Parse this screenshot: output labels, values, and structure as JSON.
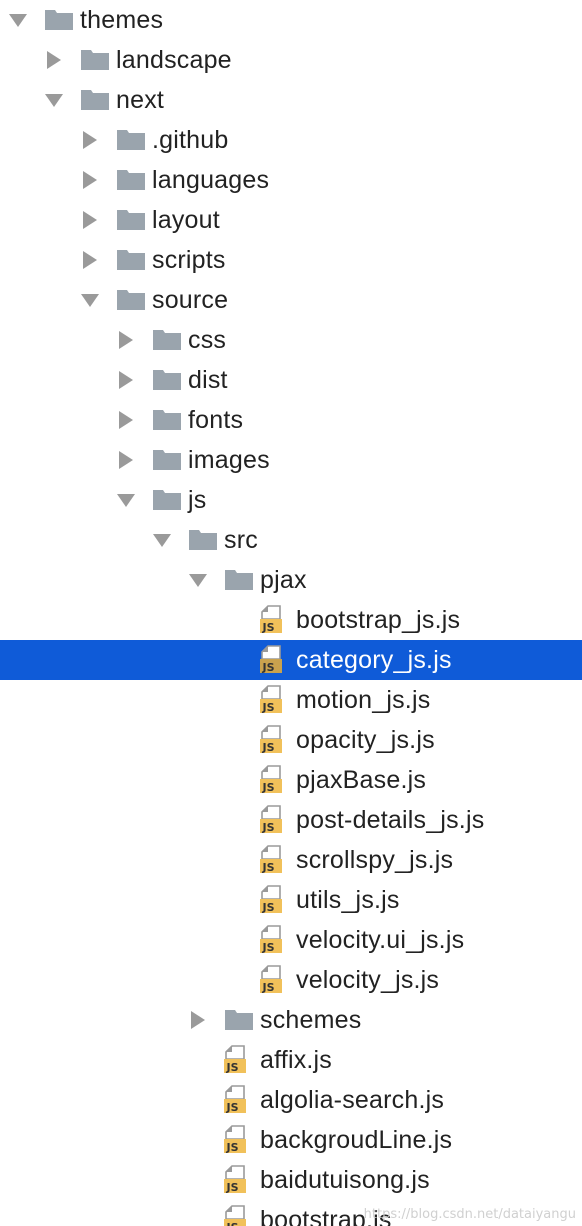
{
  "tree": [
    {
      "label": "themes",
      "type": "folder",
      "depth": 0,
      "expanded": true
    },
    {
      "label": "landscape",
      "type": "folder",
      "depth": 1,
      "expanded": false
    },
    {
      "label": "next",
      "type": "folder",
      "depth": 1,
      "expanded": true
    },
    {
      "label": ".github",
      "type": "folder",
      "depth": 2,
      "expanded": false
    },
    {
      "label": "languages",
      "type": "folder",
      "depth": 2,
      "expanded": false
    },
    {
      "label": "layout",
      "type": "folder",
      "depth": 2,
      "expanded": false
    },
    {
      "label": "scripts",
      "type": "folder",
      "depth": 2,
      "expanded": false
    },
    {
      "label": "source",
      "type": "folder",
      "depth": 2,
      "expanded": true
    },
    {
      "label": "css",
      "type": "folder",
      "depth": 3,
      "expanded": false
    },
    {
      "label": "dist",
      "type": "folder",
      "depth": 3,
      "expanded": false
    },
    {
      "label": "fonts",
      "type": "folder",
      "depth": 3,
      "expanded": false
    },
    {
      "label": "images",
      "type": "folder",
      "depth": 3,
      "expanded": false
    },
    {
      "label": "js",
      "type": "folder",
      "depth": 3,
      "expanded": true
    },
    {
      "label": "src",
      "type": "folder",
      "depth": 4,
      "expanded": true
    },
    {
      "label": "pjax",
      "type": "folder",
      "depth": 5,
      "expanded": true
    },
    {
      "label": "bootstrap_js.js",
      "type": "js-file",
      "depth": 6
    },
    {
      "label": "category_js.js",
      "type": "js-file",
      "depth": 6,
      "selected": true
    },
    {
      "label": "motion_js.js",
      "type": "js-file",
      "depth": 6
    },
    {
      "label": "opacity_js.js",
      "type": "js-file",
      "depth": 6
    },
    {
      "label": "pjaxBase.js",
      "type": "js-file",
      "depth": 6
    },
    {
      "label": "post-details_js.js",
      "type": "js-file",
      "depth": 6
    },
    {
      "label": "scrollspy_js.js",
      "type": "js-file",
      "depth": 6
    },
    {
      "label": "utils_js.js",
      "type": "js-file",
      "depth": 6
    },
    {
      "label": "velocity.ui_js.js",
      "type": "js-file",
      "depth": 6
    },
    {
      "label": "velocity_js.js",
      "type": "js-file",
      "depth": 6
    },
    {
      "label": "schemes",
      "type": "folder",
      "depth": 5,
      "expanded": false
    },
    {
      "label": "affix.js",
      "type": "js-file",
      "depth": 5
    },
    {
      "label": "algolia-search.js",
      "type": "js-file",
      "depth": 5
    },
    {
      "label": "backgroudLine.js",
      "type": "js-file",
      "depth": 5
    },
    {
      "label": "baidutuisong.js",
      "type": "js-file",
      "depth": 5
    },
    {
      "label": "bootstrap.js",
      "type": "js-file",
      "depth": 5
    }
  ],
  "file_badge_text": "JS",
  "watermark": "https://blog.csdn.net/dataiyangu",
  "colors": {
    "selection": "#0f5bd8",
    "folder": "#9aa4ad",
    "arrow": "#9a9a9a",
    "js_badge": "#f1c15a",
    "text": "#222222"
  }
}
